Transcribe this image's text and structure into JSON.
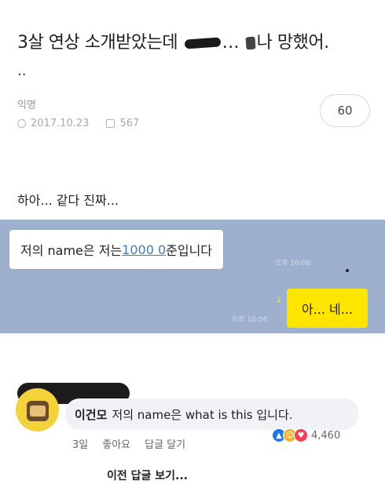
{
  "post": {
    "title_part1": "3살 연상 소개받았는데",
    "title_part2": "…",
    "title_part3": "나 망했어.",
    "title_cont": "..",
    "author": "익명",
    "date": "2017.10.23",
    "views": "567",
    "comment_count": "60",
    "body": "하아... 같다 진짜..."
  },
  "chat": {
    "left_message_prefix": "저의 name은 저는 ",
    "left_message_link": "1000 0",
    "left_message_suffix": "준입니다",
    "left_time": "오후 10:06",
    "unread": "1",
    "right_time": "오후 10:06",
    "right_message": "아... 네..."
  },
  "comment": {
    "name": "이건모",
    "text": "저의 name은 what is this 입니다.",
    "time": "3일",
    "like_label": "좋아요",
    "reply_label": "답글 달기",
    "reaction_count": "4,460",
    "previous_replies": "이전 답글 보기..."
  },
  "icons": {
    "clock": "clock-icon",
    "views": "views-icon",
    "like": "like-reaction-icon",
    "haha": "haha-reaction-icon",
    "love": "love-reaction-icon"
  },
  "colors": {
    "chat_bg": "#9db1cf",
    "yellow_bubble": "#fee500",
    "link": "#3a7fc1"
  }
}
